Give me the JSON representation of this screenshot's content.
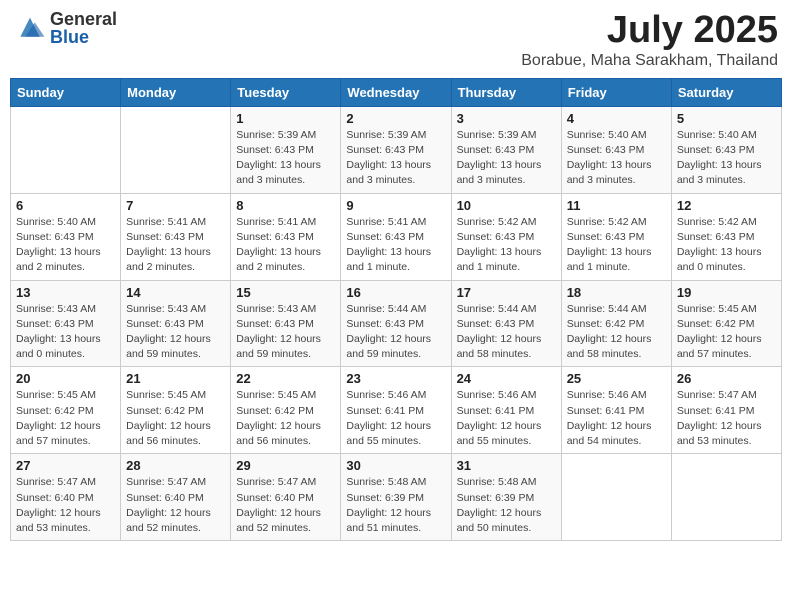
{
  "logo": {
    "general": "General",
    "blue": "Blue"
  },
  "title": "July 2025",
  "subtitle": "Borabue, Maha Sarakham, Thailand",
  "days_of_week": [
    "Sunday",
    "Monday",
    "Tuesday",
    "Wednesday",
    "Thursday",
    "Friday",
    "Saturday"
  ],
  "weeks": [
    [
      {
        "day": "",
        "info": ""
      },
      {
        "day": "",
        "info": ""
      },
      {
        "day": "1",
        "info": "Sunrise: 5:39 AM\nSunset: 6:43 PM\nDaylight: 13 hours and 3 minutes."
      },
      {
        "day": "2",
        "info": "Sunrise: 5:39 AM\nSunset: 6:43 PM\nDaylight: 13 hours and 3 minutes."
      },
      {
        "day": "3",
        "info": "Sunrise: 5:39 AM\nSunset: 6:43 PM\nDaylight: 13 hours and 3 minutes."
      },
      {
        "day": "4",
        "info": "Sunrise: 5:40 AM\nSunset: 6:43 PM\nDaylight: 13 hours and 3 minutes."
      },
      {
        "day": "5",
        "info": "Sunrise: 5:40 AM\nSunset: 6:43 PM\nDaylight: 13 hours and 3 minutes."
      }
    ],
    [
      {
        "day": "6",
        "info": "Sunrise: 5:40 AM\nSunset: 6:43 PM\nDaylight: 13 hours and 2 minutes."
      },
      {
        "day": "7",
        "info": "Sunrise: 5:41 AM\nSunset: 6:43 PM\nDaylight: 13 hours and 2 minutes."
      },
      {
        "day": "8",
        "info": "Sunrise: 5:41 AM\nSunset: 6:43 PM\nDaylight: 13 hours and 2 minutes."
      },
      {
        "day": "9",
        "info": "Sunrise: 5:41 AM\nSunset: 6:43 PM\nDaylight: 13 hours and 1 minute."
      },
      {
        "day": "10",
        "info": "Sunrise: 5:42 AM\nSunset: 6:43 PM\nDaylight: 13 hours and 1 minute."
      },
      {
        "day": "11",
        "info": "Sunrise: 5:42 AM\nSunset: 6:43 PM\nDaylight: 13 hours and 1 minute."
      },
      {
        "day": "12",
        "info": "Sunrise: 5:42 AM\nSunset: 6:43 PM\nDaylight: 13 hours and 0 minutes."
      }
    ],
    [
      {
        "day": "13",
        "info": "Sunrise: 5:43 AM\nSunset: 6:43 PM\nDaylight: 13 hours and 0 minutes."
      },
      {
        "day": "14",
        "info": "Sunrise: 5:43 AM\nSunset: 6:43 PM\nDaylight: 12 hours and 59 minutes."
      },
      {
        "day": "15",
        "info": "Sunrise: 5:43 AM\nSunset: 6:43 PM\nDaylight: 12 hours and 59 minutes."
      },
      {
        "day": "16",
        "info": "Sunrise: 5:44 AM\nSunset: 6:43 PM\nDaylight: 12 hours and 59 minutes."
      },
      {
        "day": "17",
        "info": "Sunrise: 5:44 AM\nSunset: 6:43 PM\nDaylight: 12 hours and 58 minutes."
      },
      {
        "day": "18",
        "info": "Sunrise: 5:44 AM\nSunset: 6:42 PM\nDaylight: 12 hours and 58 minutes."
      },
      {
        "day": "19",
        "info": "Sunrise: 5:45 AM\nSunset: 6:42 PM\nDaylight: 12 hours and 57 minutes."
      }
    ],
    [
      {
        "day": "20",
        "info": "Sunrise: 5:45 AM\nSunset: 6:42 PM\nDaylight: 12 hours and 57 minutes."
      },
      {
        "day": "21",
        "info": "Sunrise: 5:45 AM\nSunset: 6:42 PM\nDaylight: 12 hours and 56 minutes."
      },
      {
        "day": "22",
        "info": "Sunrise: 5:45 AM\nSunset: 6:42 PM\nDaylight: 12 hours and 56 minutes."
      },
      {
        "day": "23",
        "info": "Sunrise: 5:46 AM\nSunset: 6:41 PM\nDaylight: 12 hours and 55 minutes."
      },
      {
        "day": "24",
        "info": "Sunrise: 5:46 AM\nSunset: 6:41 PM\nDaylight: 12 hours and 55 minutes."
      },
      {
        "day": "25",
        "info": "Sunrise: 5:46 AM\nSunset: 6:41 PM\nDaylight: 12 hours and 54 minutes."
      },
      {
        "day": "26",
        "info": "Sunrise: 5:47 AM\nSunset: 6:41 PM\nDaylight: 12 hours and 53 minutes."
      }
    ],
    [
      {
        "day": "27",
        "info": "Sunrise: 5:47 AM\nSunset: 6:40 PM\nDaylight: 12 hours and 53 minutes."
      },
      {
        "day": "28",
        "info": "Sunrise: 5:47 AM\nSunset: 6:40 PM\nDaylight: 12 hours and 52 minutes."
      },
      {
        "day": "29",
        "info": "Sunrise: 5:47 AM\nSunset: 6:40 PM\nDaylight: 12 hours and 52 minutes."
      },
      {
        "day": "30",
        "info": "Sunrise: 5:48 AM\nSunset: 6:39 PM\nDaylight: 12 hours and 51 minutes."
      },
      {
        "day": "31",
        "info": "Sunrise: 5:48 AM\nSunset: 6:39 PM\nDaylight: 12 hours and 50 minutes."
      },
      {
        "day": "",
        "info": ""
      },
      {
        "day": "",
        "info": ""
      }
    ]
  ]
}
